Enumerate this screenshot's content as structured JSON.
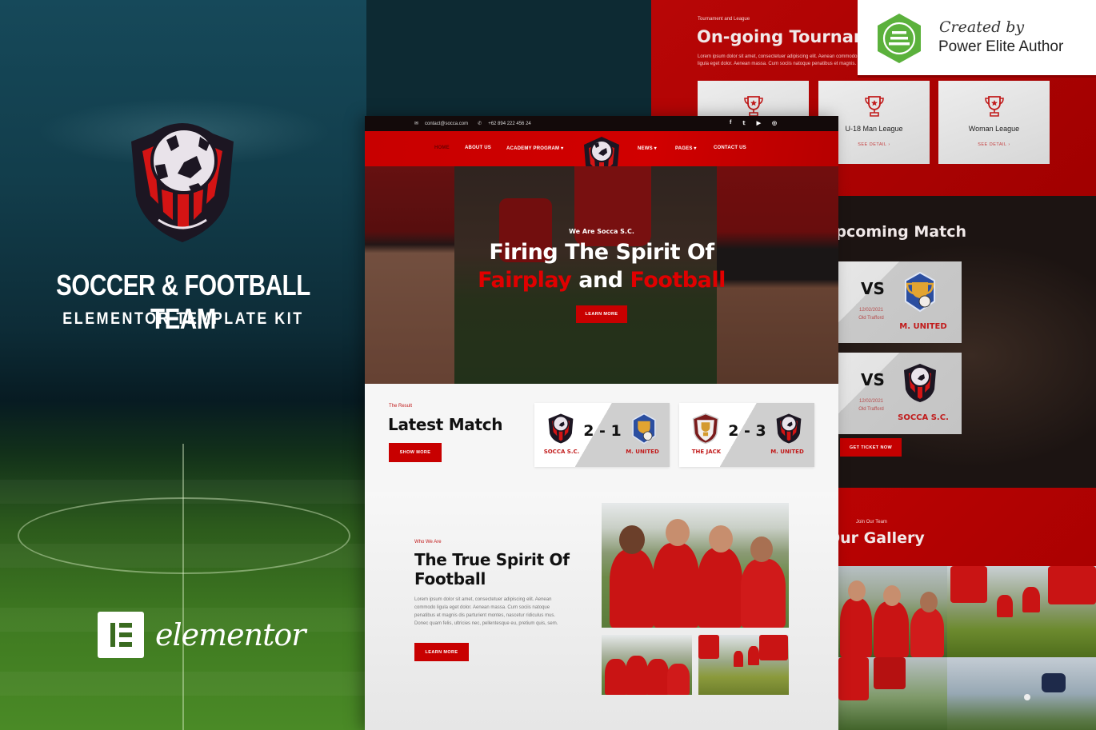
{
  "promo": {
    "title": "SOCCER & FOOTBALL TEAM",
    "subtitle": "ELEMENTOR TEMPLATE KIT",
    "builder_name": "elementor",
    "logo_icon": "soccer-shield-crest-icon"
  },
  "badge": {
    "created_by": "Created by",
    "author": "Power Elite Author",
    "icon": "envato-elite-hexagon-icon",
    "color": "#5bb13c"
  },
  "colors": {
    "brand_red": "#c80000",
    "dark": "#130a0a",
    "accent_text_red": "#c11b1b"
  },
  "site": {
    "topbar": {
      "email": "contact@socca.com",
      "phone": "+62 894 222 456 24",
      "socials": [
        "facebook",
        "twitter",
        "youtube",
        "instagram"
      ]
    },
    "nav": {
      "items": [
        {
          "label": "HOME",
          "active": true
        },
        {
          "label": "ABOUT US"
        },
        {
          "label": "ACADEMY PROGRAM ▾"
        },
        {
          "label": "NEWS ▾"
        },
        {
          "label": "PAGES ▾"
        },
        {
          "label": "CONTACT US"
        }
      ]
    },
    "hero": {
      "kicker": "We Are Socca S.C.",
      "line1": "Firing The Spirit Of",
      "line2_red_a": "Fairplay",
      "line2_white": " and ",
      "line2_red_b": "Football",
      "button": "LEARN MORE"
    },
    "latest": {
      "eyebrow": "The Result",
      "title": "Latest Match",
      "button": "SHOW MORE",
      "matches": [
        {
          "home": "SOCCA S.C.",
          "away": "M. UNITED",
          "score": "2 - 1"
        },
        {
          "home": "THE JACK",
          "away": "M. UNITED",
          "score": "2 - 3"
        }
      ]
    },
    "about": {
      "eyebrow": "Who We Are",
      "title": "The True Spirit Of Football",
      "description": "Lorem ipsum dolor sit amet, consectetuer adipiscing elit. Aenean commodo ligula eget dolor. Aenean massa. Cum sociis natoque penatibus et magnis dis parturient montes, nascetur ridiculus mus. Donec quam felis, ultricies nec, pellentesque eu, pretium quis, sem.",
      "button": "LEARN MORE"
    }
  },
  "tournaments": {
    "eyebrow": "Tournament and League",
    "title": "On-going Tournament",
    "description": "Lorem ipsum dolor sit amet, consectetuer adipiscing elit. Aenean commodo ligula eget dolor. Aenean massa. Cum sociis natoque penatibus et magnis.",
    "cards": [
      {
        "name": "",
        "link": ""
      },
      {
        "name": "U-18 Man League",
        "link": "SEE DETAIL ›"
      },
      {
        "name": "Woman League",
        "link": "SEE DETAIL ›"
      }
    ]
  },
  "upcoming": {
    "title": "Upcoming Match",
    "matches": [
      {
        "vs": "VS",
        "date": "12/02/2021",
        "venue": "Old Trafford",
        "team": "M. UNITED"
      },
      {
        "vs": "VS",
        "date": "12/02/2021",
        "venue": "Old Trafford",
        "team": "SOCCA S.C."
      }
    ],
    "button": "GET TICKET NOW"
  },
  "gallery": {
    "eyebrow": "Join Our Team",
    "title": "Our Gallery"
  }
}
